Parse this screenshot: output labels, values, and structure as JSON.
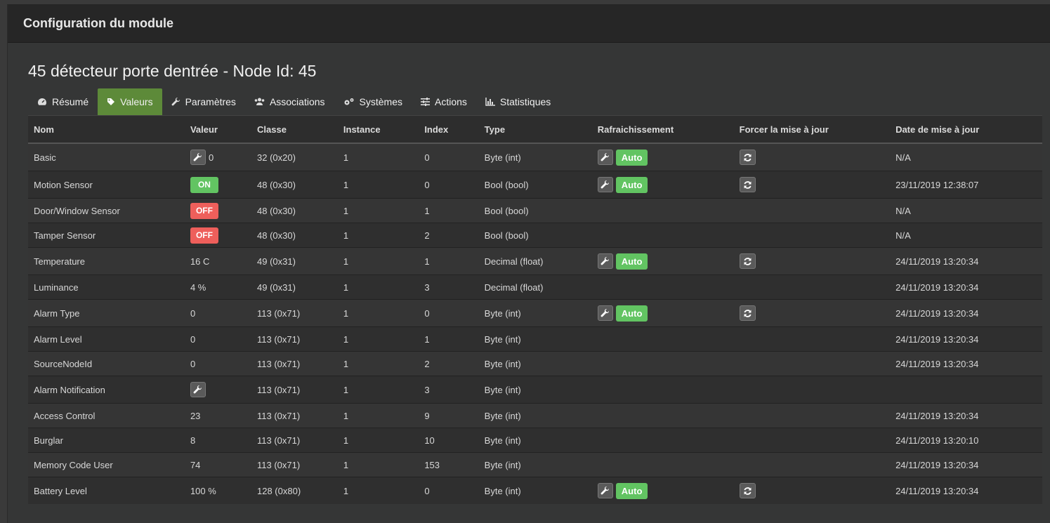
{
  "modal": {
    "title": "Configuration du module"
  },
  "node": {
    "title": "45 détecteur porte dentrée - Node Id: 45"
  },
  "tabs": [
    {
      "label": "Résumé",
      "icon": "dashboard-icon"
    },
    {
      "label": "Valeurs",
      "icon": "tag-icon"
    },
    {
      "label": "Paramètres",
      "icon": "wrench-icon"
    },
    {
      "label": "Associations",
      "icon": "users-icon"
    },
    {
      "label": "Systèmes",
      "icon": "cogs-icon"
    },
    {
      "label": "Actions",
      "icon": "sliders-icon"
    },
    {
      "label": "Statistiques",
      "icon": "bar-chart-icon"
    }
  ],
  "table": {
    "headers": [
      "Nom",
      "Valeur",
      "Classe",
      "Instance",
      "Index",
      "Type",
      "Rafraichissement",
      "Forcer la mise à jour",
      "Date de mise à jour"
    ],
    "auto_label": "Auto",
    "rows": [
      {
        "name": "Basic",
        "value": "0",
        "value_kind": "wrench-text",
        "classe": "32 (0x20)",
        "instance": "1",
        "index": "0",
        "type": "Byte (int)",
        "refresh": true,
        "force": true,
        "date": "N/A"
      },
      {
        "name": "Motion Sensor",
        "value": "ON",
        "value_kind": "badge-on",
        "classe": "48 (0x30)",
        "instance": "1",
        "index": "0",
        "type": "Bool (bool)",
        "refresh": true,
        "force": true,
        "date": "23/11/2019 12:38:07"
      },
      {
        "name": "Door/Window Sensor",
        "value": "OFF",
        "value_kind": "badge-off",
        "classe": "48 (0x30)",
        "instance": "1",
        "index": "1",
        "type": "Bool (bool)",
        "refresh": false,
        "force": false,
        "date": "N/A"
      },
      {
        "name": "Tamper Sensor",
        "value": "OFF",
        "value_kind": "badge-off",
        "classe": "48 (0x30)",
        "instance": "1",
        "index": "2",
        "type": "Bool (bool)",
        "refresh": false,
        "force": false,
        "date": "N/A"
      },
      {
        "name": "Temperature",
        "value": "16 C",
        "value_kind": "text",
        "classe": "49 (0x31)",
        "instance": "1",
        "index": "1",
        "type": "Decimal (float)",
        "refresh": true,
        "force": true,
        "date": "24/11/2019 13:20:34"
      },
      {
        "name": "Luminance",
        "value": "4 %",
        "value_kind": "text",
        "classe": "49 (0x31)",
        "instance": "1",
        "index": "3",
        "type": "Decimal (float)",
        "refresh": false,
        "force": false,
        "date": "24/11/2019 13:20:34"
      },
      {
        "name": "Alarm Type",
        "value": "0",
        "value_kind": "text",
        "classe": "113 (0x71)",
        "instance": "1",
        "index": "0",
        "type": "Byte (int)",
        "refresh": true,
        "force": true,
        "date": "24/11/2019 13:20:34"
      },
      {
        "name": "Alarm Level",
        "value": "0",
        "value_kind": "text",
        "classe": "113 (0x71)",
        "instance": "1",
        "index": "1",
        "type": "Byte (int)",
        "refresh": false,
        "force": false,
        "date": "24/11/2019 13:20:34"
      },
      {
        "name": "SourceNodeId",
        "value": "0",
        "value_kind": "text",
        "classe": "113 (0x71)",
        "instance": "1",
        "index": "2",
        "type": "Byte (int)",
        "refresh": false,
        "force": false,
        "date": "24/11/2019 13:20:34"
      },
      {
        "name": "Alarm Notification",
        "value": "",
        "value_kind": "wrench",
        "classe": "113 (0x71)",
        "instance": "1",
        "index": "3",
        "type": "Byte (int)",
        "refresh": false,
        "force": false,
        "date": ""
      },
      {
        "name": "Access Control",
        "value": "23",
        "value_kind": "text",
        "classe": "113 (0x71)",
        "instance": "1",
        "index": "9",
        "type": "Byte (int)",
        "refresh": false,
        "force": false,
        "date": "24/11/2019 13:20:34"
      },
      {
        "name": "Burglar",
        "value": "8",
        "value_kind": "text",
        "classe": "113 (0x71)",
        "instance": "1",
        "index": "10",
        "type": "Byte (int)",
        "refresh": false,
        "force": false,
        "date": "24/11/2019 13:20:10"
      },
      {
        "name": "Memory Code User",
        "value": "74",
        "value_kind": "text",
        "classe": "113 (0x71)",
        "instance": "1",
        "index": "153",
        "type": "Byte (int)",
        "refresh": false,
        "force": false,
        "date": "24/11/2019 13:20:34"
      },
      {
        "name": "Battery Level",
        "value": "100 %",
        "value_kind": "text",
        "classe": "128 (0x80)",
        "instance": "1",
        "index": "0",
        "type": "Byte (int)",
        "refresh": true,
        "force": true,
        "date": "24/11/2019 13:20:34"
      }
    ]
  },
  "colors": {
    "active_tab": "#5d8a39",
    "on": "#62c462",
    "off": "#ee5f5b",
    "auto": "#62c462"
  }
}
